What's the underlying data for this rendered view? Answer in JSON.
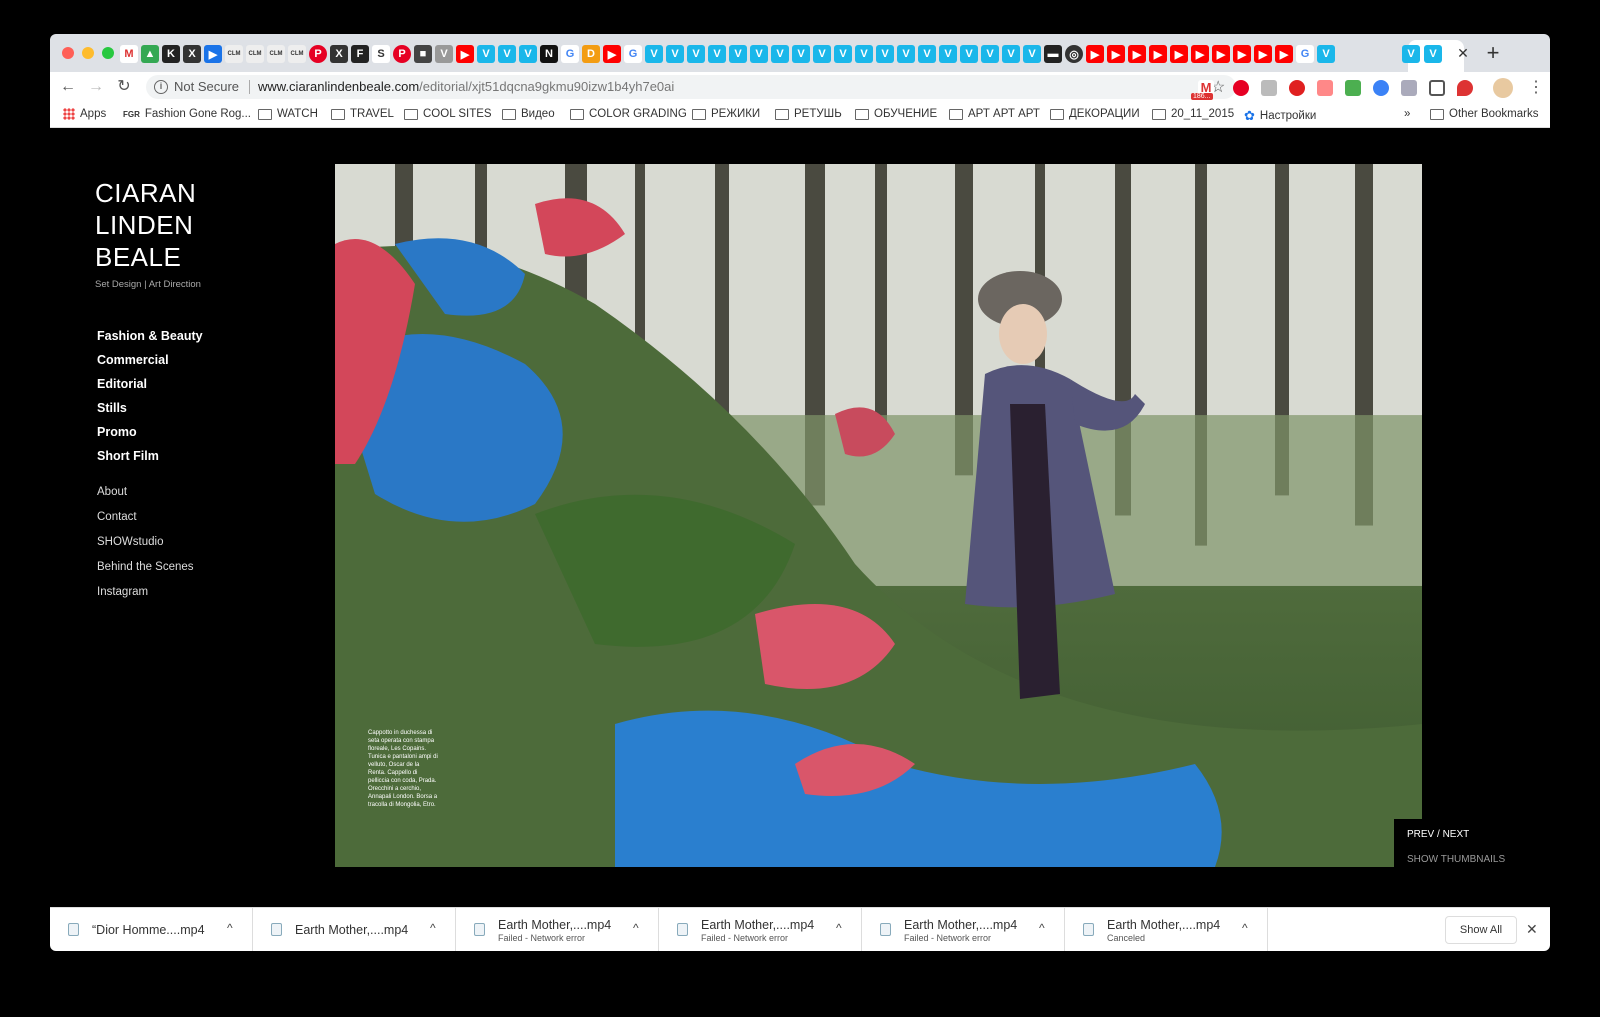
{
  "browser": {
    "address": {
      "security_label": "Not Secure",
      "url_host": "www.ciaranlindenbeale.com",
      "url_path": "/editorial/xjt51dqcna9gkmu90izw1b4yh7e0ai"
    },
    "gmail_badge": "186...",
    "bookmarks": [
      {
        "label": "Apps",
        "icon": "apps-grid-icon"
      },
      {
        "label": "Fashion Gone Rog...",
        "icon": "fgr-icon"
      },
      {
        "label": "WATCH",
        "icon": "folder-icon"
      },
      {
        "label": "TRAVEL",
        "icon": "folder-icon"
      },
      {
        "label": "COOL SITES",
        "icon": "folder-icon"
      },
      {
        "label": "Видео",
        "icon": "folder-icon"
      },
      {
        "label": "COLOR GRADING",
        "icon": "folder-icon"
      },
      {
        "label": "РЕЖИКИ",
        "icon": "folder-icon"
      },
      {
        "label": "РЕТУШЬ",
        "icon": "folder-icon"
      },
      {
        "label": "ОБУЧЕНИЕ",
        "icon": "folder-icon"
      },
      {
        "label": "АРТ АРТ АРТ",
        "icon": "folder-icon"
      },
      {
        "label": "ДЕКОРАЦИИ",
        "icon": "folder-icon"
      },
      {
        "label": "20_11_2015",
        "icon": "folder-icon"
      },
      {
        "label": "Настройки",
        "icon": "gear-icon"
      }
    ],
    "bookmarks_overflow": "»",
    "other_bookmarks": "Other Bookmarks",
    "fgr_icon_text": "FGR"
  },
  "site": {
    "brand_line1": "CIARAN",
    "brand_line2": "LINDEN",
    "brand_line3": "BEALE",
    "tagline": "Set Design  |  Art Direction",
    "nav_primary": [
      "Fashion & Beauty",
      "Commercial",
      "Editorial",
      "Stills",
      "Promo",
      "Short Film"
    ],
    "nav_secondary": [
      "About",
      "Contact",
      "SHOWstudio",
      "Behind the Scenes",
      "Instagram"
    ],
    "photo_caption": "Cappotto in duchessa di seta operata con stampa floreale, Les Copains. Tunica e pantaloni ampi di velluto, Oscar de la Renta. Cappello di pelliccia con coda, Prada. Orecchini a cerchio, Annapali London. Borsa a tracolla di Mongolia, Etro.",
    "prev_next": "PREV / NEXT",
    "show_thumbnails": "SHOW THUMBNAILS"
  },
  "downloads": [
    {
      "name": "“Dior Homme....mp4",
      "status": ""
    },
    {
      "name": "Earth Mother,....mp4",
      "status": ""
    },
    {
      "name": "Earth Mother,....mp4",
      "status": "Failed - Network error"
    },
    {
      "name": "Earth Mother,....mp4",
      "status": "Failed - Network error"
    },
    {
      "name": "Earth Mother,....mp4",
      "status": "Failed - Network error"
    },
    {
      "name": "Earth Mother,....mp4",
      "status": "Canceled"
    }
  ],
  "downloads_show_all": "Show All",
  "colors": {
    "youtube": "#ff0000",
    "vimeo": "#1ab7ea",
    "pinterest": "#e60023",
    "brand_white": "#ffffff"
  }
}
